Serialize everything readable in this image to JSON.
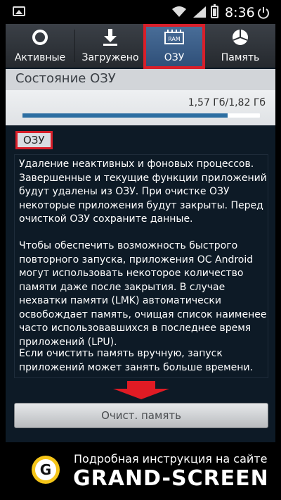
{
  "status_bar": {
    "time": "8:36"
  },
  "tabs": [
    {
      "label": "Активные",
      "icon": "active-ring-icon"
    },
    {
      "label": "Загружено",
      "icon": "download-icon"
    },
    {
      "label": "ОЗУ",
      "icon": "ram-chip-icon",
      "icon_text": "RAM",
      "selected": true
    },
    {
      "label": "Память",
      "icon": "storage-pie-icon"
    }
  ],
  "ram_status": {
    "title": "Состояние ОЗУ",
    "value": "1,57 Гб/1,82 Гб",
    "used_fraction": 0.863
  },
  "section_label": "ОЗУ",
  "description": [
    "Удаление неактивных и фоновых процессов. Завершенные и текущие функции приложений будут удалены из ОЗУ. При очистке ОЗУ некоторые приложения будут закрыты. Перед очисткой ОЗУ сохраните данные.",
    "Чтобы обеспечить возможность быстрого повторного запуска, приложения ОС Android могут использовать некоторое количество памяти даже после закрытия. В случае нехватки памяти (LMK) автоматически освобождает память, очищая список наименее часто использовавшихся в последнее время приложений (LPU).",
    "Если очистить память вручную, запуск приложений может занять больше времени."
  ],
  "clear_button": "Очист. память",
  "banner": {
    "line1": "Подробная инструкция на сайте",
    "brand": "GRAND-SCREEN",
    "logo_letter": "G"
  },
  "colors": {
    "highlight_red": "#d81f2a",
    "progress_blue": "#2c6ea2",
    "selected_tab": "#3d6290",
    "logo_yellow": "#f5c518"
  }
}
